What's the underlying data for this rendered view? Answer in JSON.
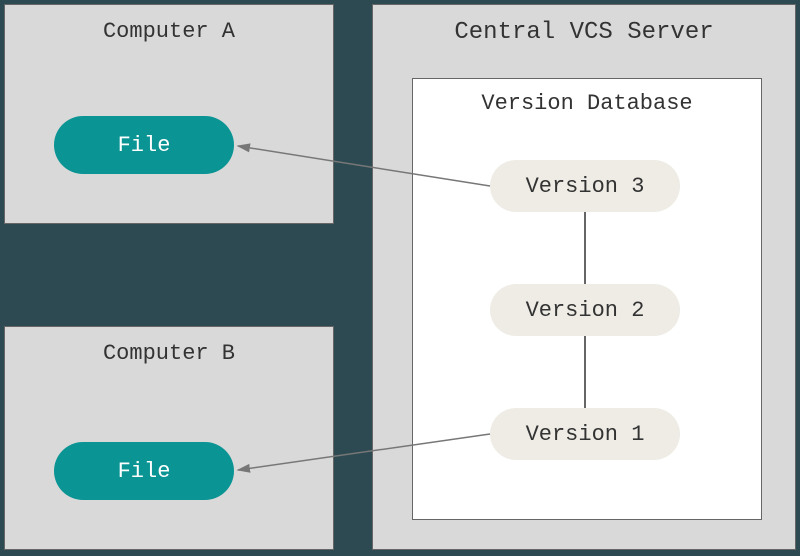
{
  "computerA": {
    "title": "Computer A",
    "file": "File"
  },
  "computerB": {
    "title": "Computer B",
    "file": "File"
  },
  "server": {
    "title": "Central VCS Server",
    "database": {
      "title": "Version Database",
      "versions": [
        "Version 3",
        "Version 2",
        "Version 1"
      ]
    }
  }
}
